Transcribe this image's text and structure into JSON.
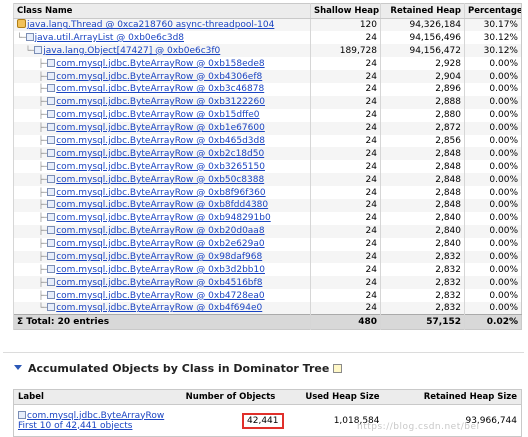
{
  "dominator_table": {
    "headers": {
      "class_name": "Class Name",
      "shallow_heap": "Shallow Heap",
      "retained_heap": "Retained Heap",
      "percentage": "Percentage"
    },
    "rows": [
      {
        "tree": "",
        "icon": "thread-icon",
        "name": "java.lang.Thread @ 0xca218760 async-threadpool-104",
        "shallow": "120",
        "retained": "94,326,184",
        "pct": "30.17%"
      },
      {
        "tree": "└─",
        "icon": "object-icon",
        "name": "java.util.ArrayList @ 0xb0e6c3d8",
        "shallow": "24",
        "retained": "94,156,496",
        "pct": "30.12%"
      },
      {
        "tree": "  └─",
        "icon": "array-icon",
        "name": "java.lang.Object[47427] @ 0xb0e6c3f0",
        "shallow": "189,728",
        "retained": "94,156,472",
        "pct": "30.12%"
      },
      {
        "tree": "     ├─",
        "icon": "object-icon",
        "name": "com.mysql.jdbc.ByteArrayRow @ 0xb158ede8",
        "shallow": "24",
        "retained": "2,928",
        "pct": "0.00%"
      },
      {
        "tree": "     ├─",
        "icon": "object-icon",
        "name": "com.mysql.jdbc.ByteArrayRow @ 0xb4306ef8",
        "shallow": "24",
        "retained": "2,904",
        "pct": "0.00%"
      },
      {
        "tree": "     ├─",
        "icon": "object-icon",
        "name": "com.mysql.jdbc.ByteArrayRow @ 0xb3c46878",
        "shallow": "24",
        "retained": "2,896",
        "pct": "0.00%"
      },
      {
        "tree": "     ├─",
        "icon": "object-icon",
        "name": "com.mysql.jdbc.ByteArrayRow @ 0xb3122260",
        "shallow": "24",
        "retained": "2,888",
        "pct": "0.00%"
      },
      {
        "tree": "     ├─",
        "icon": "object-icon",
        "name": "com.mysql.jdbc.ByteArrayRow @ 0xb15dffe0",
        "shallow": "24",
        "retained": "2,880",
        "pct": "0.00%"
      },
      {
        "tree": "     ├─",
        "icon": "object-icon",
        "name": "com.mysql.jdbc.ByteArrayRow @ 0xb1e67600",
        "shallow": "24",
        "retained": "2,872",
        "pct": "0.00%"
      },
      {
        "tree": "     ├─",
        "icon": "object-icon",
        "name": "com.mysql.jdbc.ByteArrayRow @ 0xb465d3d8",
        "shallow": "24",
        "retained": "2,856",
        "pct": "0.00%"
      },
      {
        "tree": "     ├─",
        "icon": "object-icon",
        "name": "com.mysql.jdbc.ByteArrayRow @ 0xb2c18d50",
        "shallow": "24",
        "retained": "2,848",
        "pct": "0.00%"
      },
      {
        "tree": "     ├─",
        "icon": "object-icon",
        "name": "com.mysql.jdbc.ByteArrayRow @ 0xb3265150",
        "shallow": "24",
        "retained": "2,848",
        "pct": "0.00%"
      },
      {
        "tree": "     ├─",
        "icon": "object-icon",
        "name": "com.mysql.jdbc.ByteArrayRow @ 0xb50c8388",
        "shallow": "24",
        "retained": "2,848",
        "pct": "0.00%"
      },
      {
        "tree": "     ├─",
        "icon": "object-icon",
        "name": "com.mysql.jdbc.ByteArrayRow @ 0xb8f96f360",
        "shallow": "24",
        "retained": "2,848",
        "pct": "0.00%"
      },
      {
        "tree": "     ├─",
        "icon": "object-icon",
        "name": "com.mysql.jdbc.ByteArrayRow @ 0xb8fdd4380",
        "shallow": "24",
        "retained": "2,848",
        "pct": "0.00%"
      },
      {
        "tree": "     ├─",
        "icon": "object-icon",
        "name": "com.mysql.jdbc.ByteArrayRow @ 0xb948291b0",
        "shallow": "24",
        "retained": "2,840",
        "pct": "0.00%"
      },
      {
        "tree": "     ├─",
        "icon": "object-icon",
        "name": "com.mysql.jdbc.ByteArrayRow @ 0xb20d0aa8",
        "shallow": "24",
        "retained": "2,840",
        "pct": "0.00%"
      },
      {
        "tree": "     ├─",
        "icon": "object-icon",
        "name": "com.mysql.jdbc.ByteArrayRow @ 0xb2e629a0",
        "shallow": "24",
        "retained": "2,840",
        "pct": "0.00%"
      },
      {
        "tree": "     ├─",
        "icon": "object-icon",
        "name": "com.mysql.jdbc.ByteArrayRow @ 0x98daf968",
        "shallow": "24",
        "retained": "2,832",
        "pct": "0.00%"
      },
      {
        "tree": "     ├─",
        "icon": "object-icon",
        "name": "com.mysql.jdbc.ByteArrayRow @ 0xb3d2bb10",
        "shallow": "24",
        "retained": "2,832",
        "pct": "0.00%"
      },
      {
        "tree": "     ├─",
        "icon": "object-icon",
        "name": "com.mysql.jdbc.ByteArrayRow @ 0xb4516bf8",
        "shallow": "24",
        "retained": "2,832",
        "pct": "0.00%"
      },
      {
        "tree": "     ├─",
        "icon": "object-icon",
        "name": "com.mysql.jdbc.ByteArrayRow @ 0xb4728ea0",
        "shallow": "24",
        "retained": "2,832",
        "pct": "0.00%"
      },
      {
        "tree": "     └─",
        "icon": "object-icon",
        "name": "com.mysql.jdbc.ByteArrayRow @ 0xb4f694e0",
        "shallow": "24",
        "retained": "2,832",
        "pct": "0.00%"
      }
    ],
    "total": {
      "label": "Σ Total: 20 entries",
      "shallow": "480",
      "retained": "57,152",
      "pct": "0.02%"
    }
  },
  "accumulated_section": {
    "title": "Accumulated Objects by Class in Dominator Tree",
    "headers": {
      "label": "Label",
      "num_objects": "Number of Objects",
      "used_heap": "Used Heap Size",
      "retained_heap": "Retained Heap Size"
    },
    "row": {
      "label": "com.mysql.jdbc.ByteArrayRow",
      "sublabel": "First 10 of 42,441 objects",
      "num_objects": "42,441",
      "used_heap": "1,018,584",
      "retained_heap": "93,966,744"
    }
  },
  "watermark": "https://blog.csdn.net/bel",
  "colors": {
    "link": "#1a44c2",
    "highlight_box": "#e0302b",
    "header_bg": "#ececec",
    "total_bg": "#d8d8d8"
  }
}
